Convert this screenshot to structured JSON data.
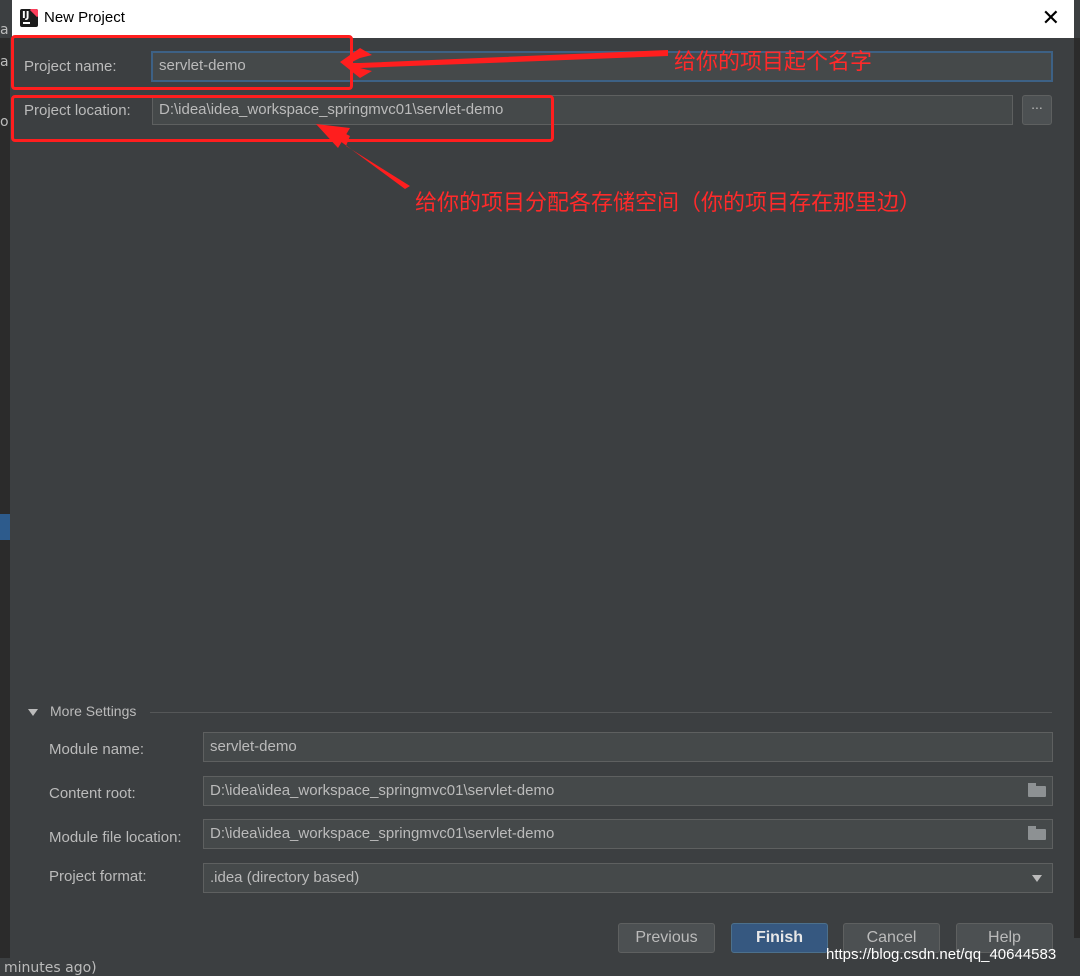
{
  "window": {
    "title": "New Project"
  },
  "background": {
    "edge_chars": [
      "a",
      "a",
      "o"
    ],
    "status_text": "minutes ago)"
  },
  "form": {
    "project_name_label": "Project name:",
    "project_name_value": "servlet-demo",
    "project_location_label": "Project location:",
    "project_location_value": "D:\\idea\\idea_workspace_springmvc01\\servlet-demo",
    "browse_label": "..."
  },
  "annotations": {
    "name_note": "给你的项目起个名字",
    "location_note": "给你的项目分配各存储空间（你的项目存在那里边）",
    "color": "#ff1e1e"
  },
  "more_settings": {
    "title": "More Settings",
    "module_name_label": "Module name:",
    "module_name_value": "servlet-demo",
    "content_root_label": "Content root:",
    "content_root_value": "D:\\idea\\idea_workspace_springmvc01\\servlet-demo",
    "module_file_label": "Module file location:",
    "module_file_value": "D:\\idea\\idea_workspace_springmvc01\\servlet-demo",
    "project_format_label": "Project format:",
    "project_format_value": ".idea (directory based)"
  },
  "buttons": {
    "previous": "Previous",
    "finish": "Finish",
    "cancel": "Cancel",
    "help": "Help"
  },
  "watermark": "https://blog.csdn.net/qq_40644583",
  "colors": {
    "dialog_bg": "#3c3f41",
    "field_bg": "#45494a",
    "focus_border": "#3d6185",
    "primary_button": "#365880"
  }
}
